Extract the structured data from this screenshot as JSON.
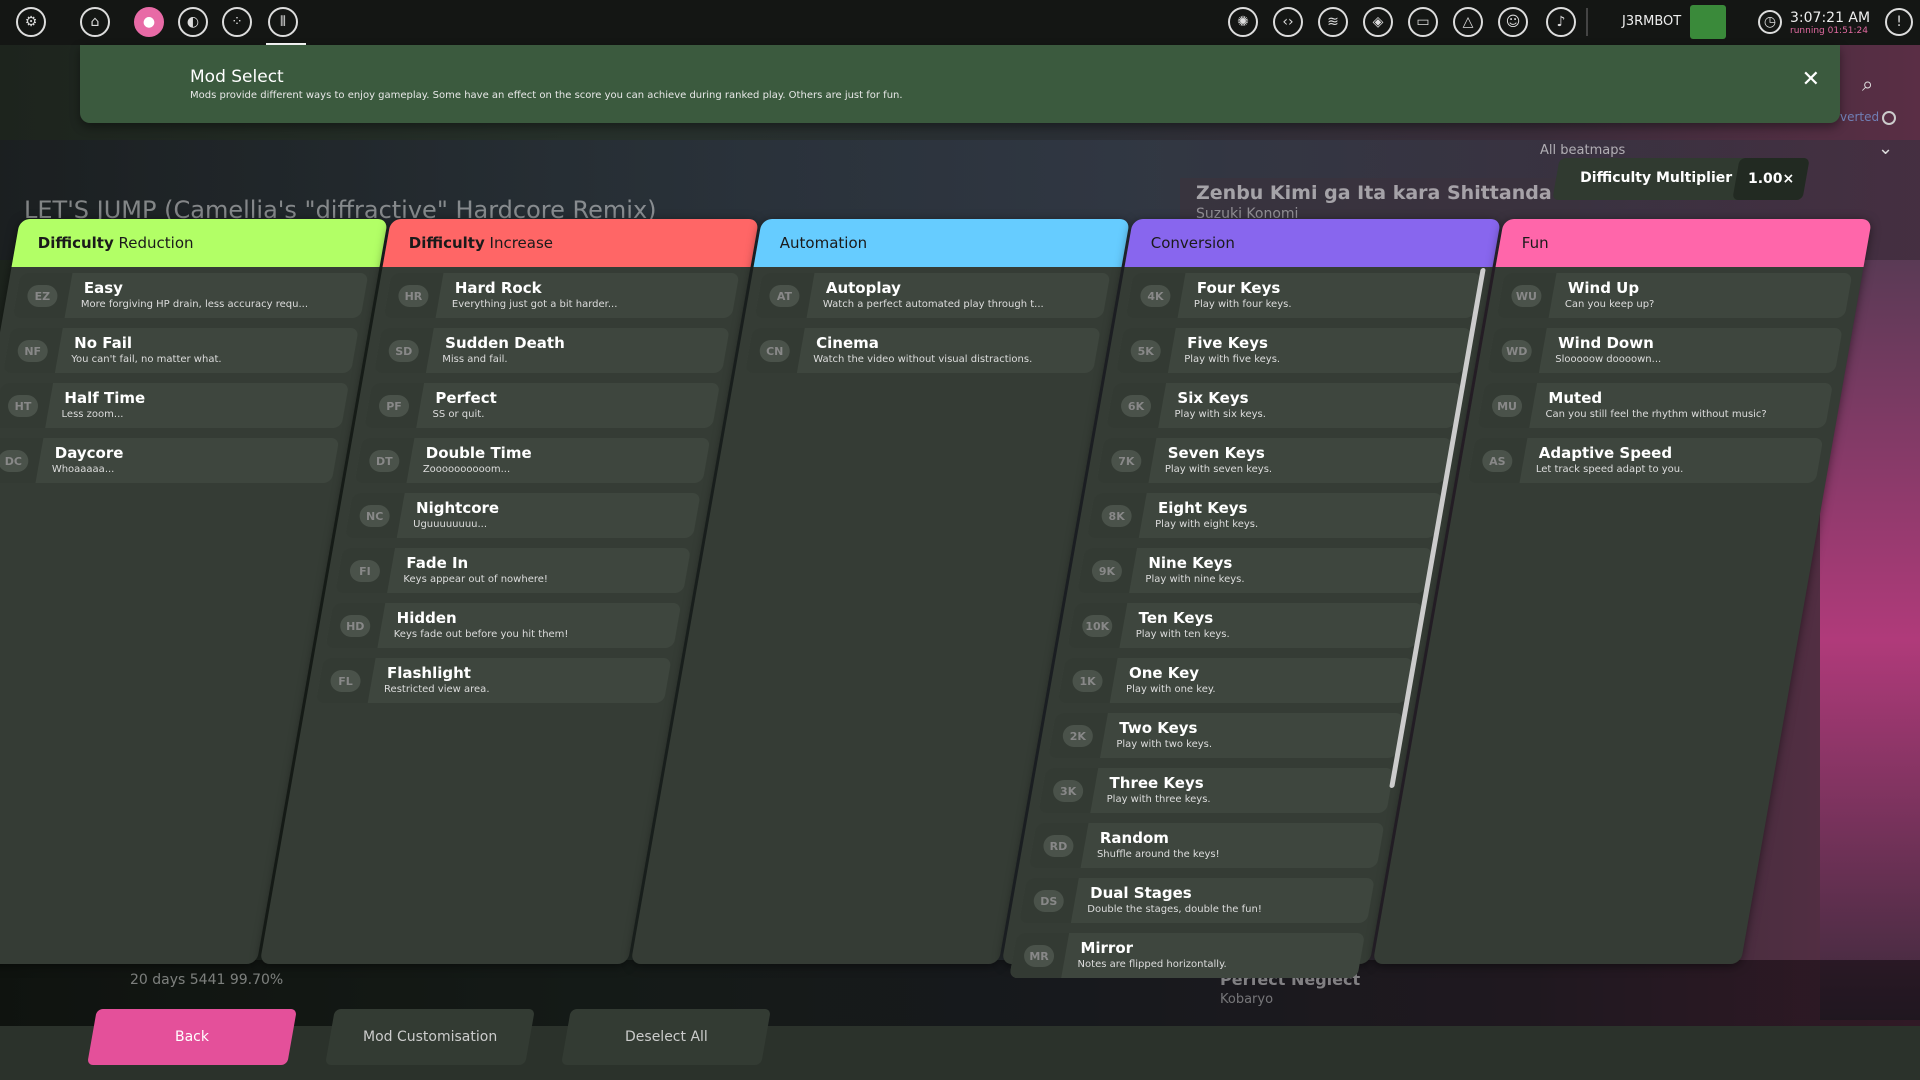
{
  "topbar": {
    "user": "J3RMBOT",
    "time": "3:07:21 AM",
    "running": "running 01:51:24"
  },
  "background": {
    "song_title": "LET'S JUMP (Camellia's \"diffractive\" Hardcore Remix)",
    "card_title": "Zenbu Kimi ga Ita kara Shittanda",
    "card_artist": "Suzuki Konomi",
    "bottom_rank": "20 days   5441   99.70%",
    "bottom_title": "Perfect Neglect",
    "bottom_artist": "Kobaryo"
  },
  "header": {
    "title": "Mod Select",
    "description": "Mods provide different ways to enjoy gameplay. Some have an effect on the score you can achieve during ranked play. Others are just for fun.",
    "close": "✕"
  },
  "side": {
    "inverted": "verted",
    "all_beatmaps": "All beatmaps"
  },
  "multiplier": {
    "label": "Difficulty Multiplier",
    "value": "1.00×"
  },
  "columns": [
    {
      "title_bold": "Difficulty",
      "title_rest": " Reduction",
      "color": "#b2ff66",
      "mods": [
        {
          "abbr": "EZ",
          "name": "Easy",
          "desc": "More forgiving HP drain, less accuracy requ..."
        },
        {
          "abbr": "NF",
          "name": "No Fail",
          "desc": "You can't fail, no matter what."
        },
        {
          "abbr": "HT",
          "name": "Half Time",
          "desc": "Less zoom..."
        },
        {
          "abbr": "DC",
          "name": "Daycore",
          "desc": "Whoaaaaa..."
        }
      ]
    },
    {
      "title_bold": "Difficulty",
      "title_rest": " Increase",
      "color": "#ff6666",
      "mods": [
        {
          "abbr": "HR",
          "name": "Hard Rock",
          "desc": "Everything just got a bit harder..."
        },
        {
          "abbr": "SD",
          "name": "Sudden Death",
          "desc": "Miss and fail."
        },
        {
          "abbr": "PF",
          "name": "Perfect",
          "desc": "SS or quit."
        },
        {
          "abbr": "DT",
          "name": "Double Time",
          "desc": "Zoooooooooom..."
        },
        {
          "abbr": "NC",
          "name": "Nightcore",
          "desc": "Uguuuuuuuu..."
        },
        {
          "abbr": "FI",
          "name": "Fade In",
          "desc": "Keys appear out of nowhere!"
        },
        {
          "abbr": "HD",
          "name": "Hidden",
          "desc": "Keys fade out before you hit them!"
        },
        {
          "abbr": "FL",
          "name": "Flashlight",
          "desc": "Restricted view area."
        }
      ]
    },
    {
      "title_bold": "",
      "title_rest": "Automation",
      "color": "#66ccff",
      "mods": [
        {
          "abbr": "AT",
          "name": "Autoplay",
          "desc": "Watch a perfect automated play through t..."
        },
        {
          "abbr": "CN",
          "name": "Cinema",
          "desc": "Watch the video without visual distractions."
        }
      ]
    },
    {
      "title_bold": "",
      "title_rest": "Conversion",
      "color": "#8866ee",
      "mods": [
        {
          "abbr": "4K",
          "name": "Four Keys",
          "desc": "Play with four keys."
        },
        {
          "abbr": "5K",
          "name": "Five Keys",
          "desc": "Play with five keys."
        },
        {
          "abbr": "6K",
          "name": "Six Keys",
          "desc": "Play with six keys."
        },
        {
          "abbr": "7K",
          "name": "Seven Keys",
          "desc": "Play with seven keys."
        },
        {
          "abbr": "8K",
          "name": "Eight Keys",
          "desc": "Play with eight keys."
        },
        {
          "abbr": "9K",
          "name": "Nine Keys",
          "desc": "Play with nine keys."
        },
        {
          "abbr": "10K",
          "name": "Ten Keys",
          "desc": "Play with ten keys."
        },
        {
          "abbr": "1K",
          "name": "One Key",
          "desc": "Play with one key."
        },
        {
          "abbr": "2K",
          "name": "Two Keys",
          "desc": "Play with two keys."
        },
        {
          "abbr": "3K",
          "name": "Three Keys",
          "desc": "Play with three keys."
        },
        {
          "abbr": "RD",
          "name": "Random",
          "desc": "Shuffle around the keys!"
        },
        {
          "abbr": "DS",
          "name": "Dual Stages",
          "desc": "Double the stages, double the fun!"
        },
        {
          "abbr": "MR",
          "name": "Mirror",
          "desc": "Notes are flipped horizontally."
        }
      ]
    },
    {
      "title_bold": "",
      "title_rest": "Fun",
      "color": "#ff66aa",
      "mods": [
        {
          "abbr": "WU",
          "name": "Wind Up",
          "desc": "Can you keep up?"
        },
        {
          "abbr": "WD",
          "name": "Wind Down",
          "desc": "Slooooow doooown..."
        },
        {
          "abbr": "MU",
          "name": "Muted",
          "desc": "Can you still feel the rhythm without music?"
        },
        {
          "abbr": "AS",
          "name": "Adaptive Speed",
          "desc": "Let track speed adapt to you."
        }
      ]
    }
  ],
  "footer": {
    "back": "Back",
    "customisation": "Mod Customisation",
    "deselect": "Deselect All"
  }
}
